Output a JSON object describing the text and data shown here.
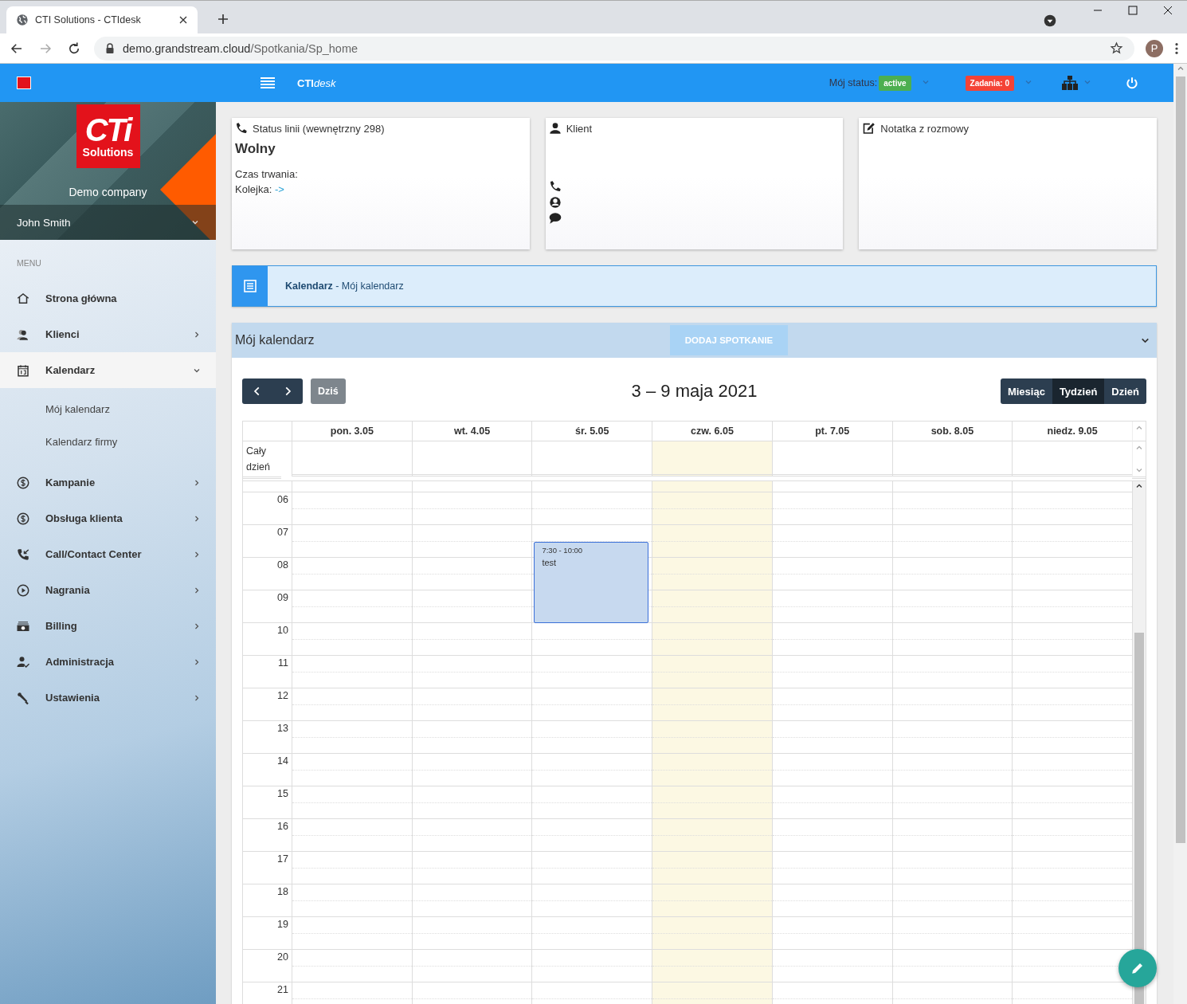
{
  "browser": {
    "tab_title": "CTI Solutions - CTIdesk",
    "url_host": "demo.grandstream.cloud",
    "url_path": "/Spotkania/Sp_home",
    "profile_initial": "P"
  },
  "header": {
    "brand_bold": "CTI",
    "brand_italic": "desk",
    "status_label": "Mój status:",
    "status_badge": "active",
    "tasks_badge": "Zadania: 0"
  },
  "sidebar": {
    "logo_top": "CTi",
    "logo_bottom": "Solutions",
    "company": "Demo company",
    "user": "John Smith",
    "menu_label": "MENU",
    "items": [
      {
        "kind": "link",
        "label": "Strona główna",
        "selected": false
      },
      {
        "kind": "group",
        "label": "Klienci",
        "selected": false,
        "expanded": false
      },
      {
        "kind": "group",
        "label": "Kalendarz",
        "selected": true,
        "expanded": true,
        "children": [
          {
            "label": "Mój kalendarz",
            "selected": false
          },
          {
            "label": "Kalendarz firmy",
            "selected": false
          }
        ]
      },
      {
        "kind": "group",
        "label": "Kampanie",
        "selected": false,
        "expanded": false
      },
      {
        "kind": "group",
        "label": "Obsługa klienta",
        "selected": false,
        "expanded": false
      },
      {
        "kind": "group",
        "label": "Call/Contact Center",
        "selected": false,
        "expanded": false
      },
      {
        "kind": "group",
        "label": "Nagrania",
        "selected": false,
        "expanded": false
      },
      {
        "kind": "group",
        "label": "Billing",
        "selected": false,
        "expanded": false
      },
      {
        "kind": "group",
        "label": "Administracja",
        "selected": false,
        "expanded": false
      },
      {
        "kind": "group",
        "label": "Ustawienia",
        "selected": false,
        "expanded": false
      }
    ]
  },
  "cards": [
    {
      "kind": "line",
      "title": "Status linii (wewnętrzny 298)",
      "status": "Wolny",
      "fields": [
        {
          "label": "Czas trwania:"
        },
        {
          "label": "Kolejka:",
          "link": "->"
        }
      ]
    },
    {
      "kind": "client",
      "title": "Klient"
    },
    {
      "kind": "note",
      "title": "Notatka z rozmowy"
    }
  ],
  "breadcrumb": "**Kalendarz** - Mój kalendarz",
  "calendar": {
    "panel_title": "Mój kalendarz",
    "add_button": "DODAJ SPOTKANIE",
    "today_button": "Dziś",
    "range_title": "3 – 9 maja 2021",
    "views": [
      {
        "label": "Miesiąc",
        "selected": false
      },
      {
        "label": "Tydzień",
        "selected": true
      },
      {
        "label": "Dzień",
        "selected": false
      }
    ],
    "all_day_label": "Cały dzień",
    "days": [
      {
        "label": "pon. 3.05",
        "today": false
      },
      {
        "label": "wt. 4.05",
        "today": false
      },
      {
        "label": "śr. 5.05",
        "today": false,
        "events": [
          {
            "time": "7:30 - 10:00",
            "title": "test"
          }
        ]
      },
      {
        "label": "czw. 6.05",
        "today": true
      },
      {
        "label": "pt. 7.05",
        "today": false
      },
      {
        "label": "sob. 8.05",
        "today": false
      },
      {
        "label": "niedz. 9.05",
        "today": false
      }
    ],
    "hours": [
      "06",
      "07",
      "08",
      "09",
      "10",
      "11",
      "12",
      "13",
      "14",
      "15",
      "16",
      "17",
      "18",
      "19",
      "20",
      "21"
    ]
  }
}
